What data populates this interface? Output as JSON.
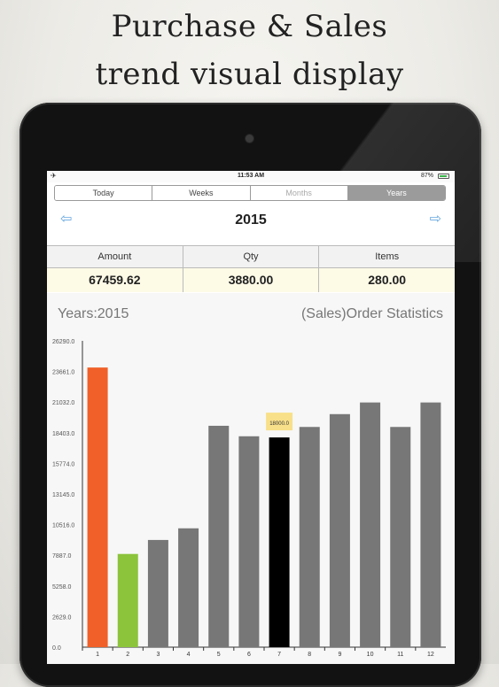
{
  "headline": {
    "line1": "Purchase & Sales",
    "line2": "trend visual display"
  },
  "status_bar": {
    "airplane_icon": "airplane-icon",
    "time": "11:53 AM",
    "battery": "87%"
  },
  "segmented_control": {
    "options": [
      "Today",
      "Weeks",
      "Months",
      "Years"
    ],
    "selected": "Years"
  },
  "nav": {
    "title": "2015",
    "prev_icon": "arrow-left-icon",
    "next_icon": "arrow-right-icon"
  },
  "stats": {
    "headers": [
      "Amount",
      "Qty",
      "Items"
    ],
    "values": [
      "67459.62",
      "3880.00",
      "280.00"
    ]
  },
  "chart_titles": {
    "left": "Years:2015",
    "right": "(Sales)Order Statistics"
  },
  "chart_data": {
    "type": "bar",
    "title": "(Sales)Order Statistics",
    "categories": [
      "1",
      "2",
      "3",
      "4",
      "5",
      "6",
      "7",
      "8",
      "9",
      "10",
      "11",
      "12"
    ],
    "values": [
      24000,
      8000,
      9200,
      10200,
      19000,
      18100,
      18000,
      18900,
      20000,
      21000,
      18900,
      21000
    ],
    "colors": [
      "#f06028",
      "#8cc43c",
      "#777777",
      "#777777",
      "#777777",
      "#777777",
      "#000000",
      "#777777",
      "#777777",
      "#777777",
      "#777777",
      "#777777"
    ],
    "yticks": [
      "0.0",
      "2629.0",
      "5258.0",
      "7887.0",
      "10516.0",
      "13145.0",
      "15774.0",
      "18403.0",
      "21032.0",
      "23661.0",
      "26290.0"
    ],
    "ylim": [
      0,
      26290
    ],
    "highlight": {
      "index": 6,
      "label": "18000.0",
      "color": "#f8e08a"
    },
    "grid": false
  }
}
